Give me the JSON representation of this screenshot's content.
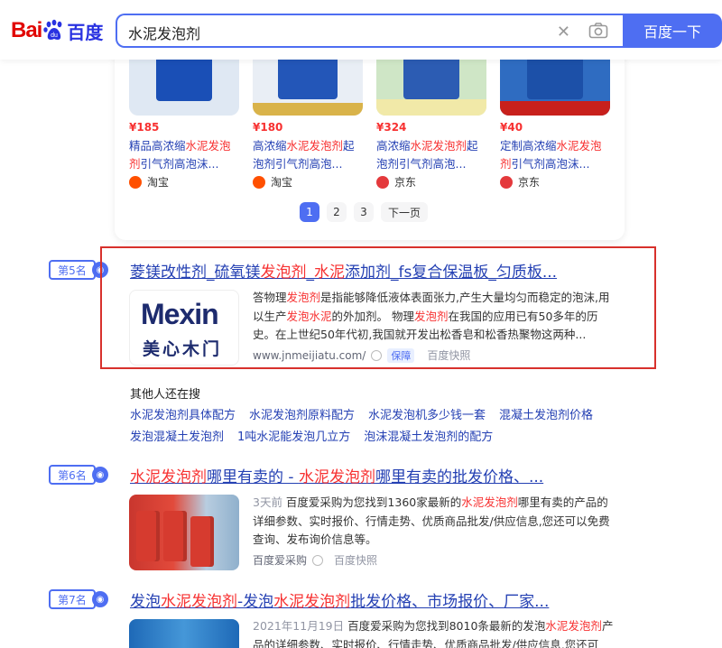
{
  "header": {
    "logo_bai": "Bai",
    "logo_du": "百度",
    "query": "水泥发泡剂",
    "search_button": "百度一下",
    "clear_symbol": "✕"
  },
  "shopping": {
    "products": [
      {
        "price": "¥185",
        "title_pre": "精品高浓缩",
        "title_em": "水泥发泡",
        "title_mid": "",
        "title_em2": "剂",
        "title_post": "引气剂高泡沫...",
        "shop": "淘宝",
        "shop_color": "#ff5000"
      },
      {
        "price": "¥180",
        "title_pre": "高浓缩",
        "title_em": "水泥发泡剂",
        "title_mid": "起泡剂引气剂高泡...",
        "title_em2": "",
        "title_post": "",
        "shop": "淘宝",
        "shop_color": "#ff5000"
      },
      {
        "price": "¥324",
        "title_pre": "高浓缩",
        "title_em": "水泥发泡剂",
        "title_mid": "起泡剂引气剂高泡...",
        "title_em2": "",
        "title_post": "",
        "shop": "京东",
        "shop_color": "#e4393c"
      },
      {
        "price": "¥40",
        "title_pre": "定制高浓缩",
        "title_em": "水泥发泡",
        "title_mid": "",
        "title_em2": "剂",
        "title_post": "引气剂高泡沫...",
        "shop": "京东",
        "shop_color": "#e4393c"
      }
    ],
    "pages": [
      "1",
      "2",
      "3"
    ],
    "next_page": "下一页"
  },
  "results": [
    {
      "rank": "第5名",
      "title_parts": [
        "菱镁改性剂_硫氧镁",
        "发泡剂",
        "_",
        "水泥",
        "添加剂_fs复合保温板_匀质板..."
      ],
      "logo_line1": "Mexin",
      "logo_line2": "美心木门",
      "abstract_parts": [
        "答物理",
        "发泡剂",
        "是指能够降低液体表面张力,产生大量均匀而稳定的泡沫,用以生产",
        "发泡水泥",
        "的外加剂。 物理",
        "发泡剂",
        "在我国的应用已有50多年的历史。在上世纪50年代初,我国就开发出松香皂和松香热聚物这两种..."
      ],
      "url": "www.jnmeijiatu.com/",
      "badge": "保障",
      "snapshot": "百度快照"
    },
    {
      "rank": "第6名",
      "title_parts": [
        "水泥发泡剂",
        "哪里有卖的 - ",
        "水泥发泡剂",
        "哪里有卖的批发价格、..."
      ],
      "date": "3天前",
      "abstract_parts": [
        " 百度爱采购为您找到1360家最新的",
        "水泥发泡剂",
        "哪里有卖的产品的详细参数、实时报价、行情走势、优质商品批发/供应信息,您还可以免费查询、发布询价信息等。"
      ],
      "source": "百度爱采购",
      "snapshot": "百度快照"
    },
    {
      "rank": "第7名",
      "title_parts": [
        "发泡",
        "水泥发泡剂",
        "-发泡",
        "水泥发泡剂",
        "批发价格、市场报价、厂家..."
      ],
      "date": "2021年11月19日",
      "abstract_parts": [
        " 百度爱采购为您找到8010条最新的发泡",
        "水泥发泡剂",
        "产品的详细参数、实时报价、行情走势、优质商品批发/供应信息,您还可以..."
      ]
    }
  ],
  "others": {
    "title": "其他人还在搜",
    "row1": [
      "水泥发泡剂具体配方",
      "水泥发泡剂原料配方",
      "水泥发泡机多少钱一套",
      "混凝土发泡剂价格"
    ],
    "row2": [
      "发泡混凝土发泡剂",
      "1吨水泥能发泡几立方",
      "泡沫混凝土发泡剂的配方"
    ]
  },
  "colors": {
    "brand_blue": "#4e6ef2",
    "link_blue": "#2440b3",
    "highlight_red": "#f73131",
    "box_red": "#d8312c"
  }
}
